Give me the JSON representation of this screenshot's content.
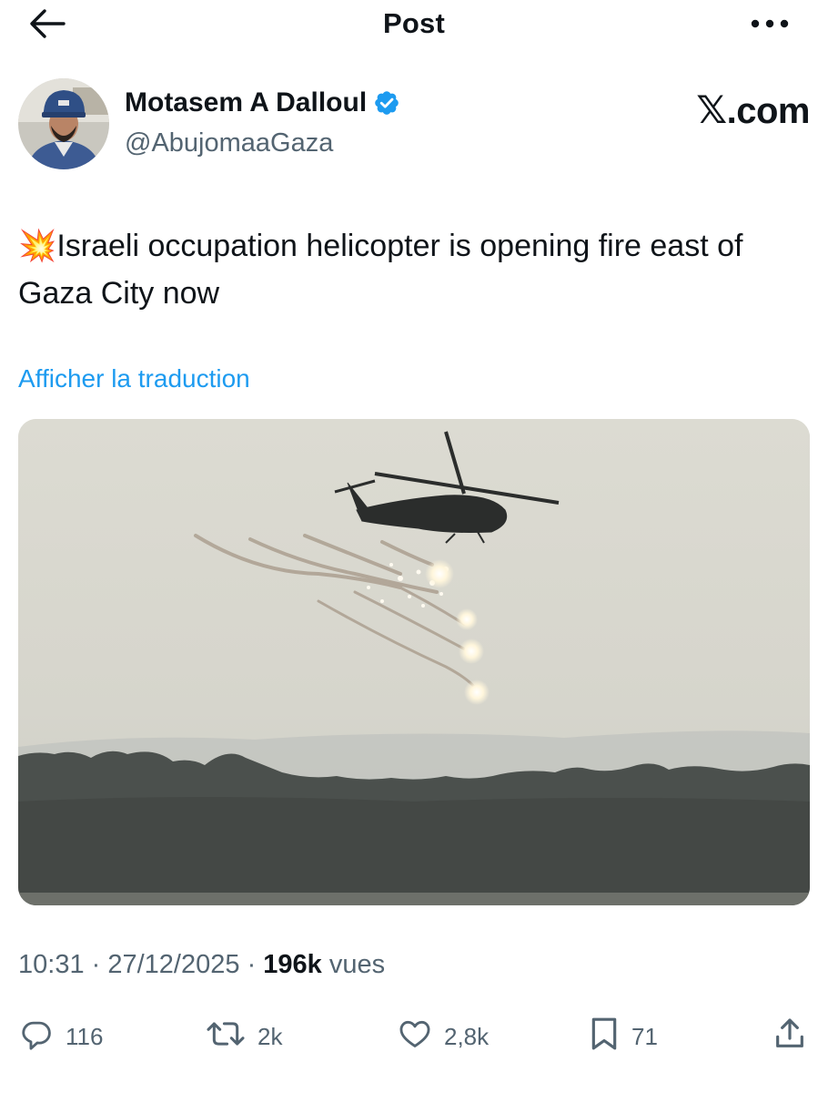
{
  "header": {
    "title": "Post",
    "back_icon": "arrow-left-icon",
    "more_icon": "more-horizontal-icon"
  },
  "author": {
    "name": "Motasem A Dalloul",
    "handle": "@AbujomaaGaza",
    "verified": true,
    "verified_color": "#1d9bf0"
  },
  "watermark": {
    "x_glyph": "𝕏",
    "suffix": ".com"
  },
  "post": {
    "emoji": "💥",
    "text": "Israeli occupation helicopter is opening fire east of Gaza City now",
    "translate_label": "Afficher la traduction",
    "media_description_icon": "photo"
  },
  "meta": {
    "time": "10:31",
    "sep1": " · ",
    "date": "27/12/2025",
    "sep2": " · ",
    "views_count": "196k",
    "views_label": " vues"
  },
  "actions": {
    "replies": "116",
    "reposts": "2k",
    "likes": "2,8k",
    "bookmarks": "71"
  },
  "colors": {
    "accent": "#1d9bf0",
    "text_primary": "#0f1419",
    "text_secondary": "#536471"
  }
}
